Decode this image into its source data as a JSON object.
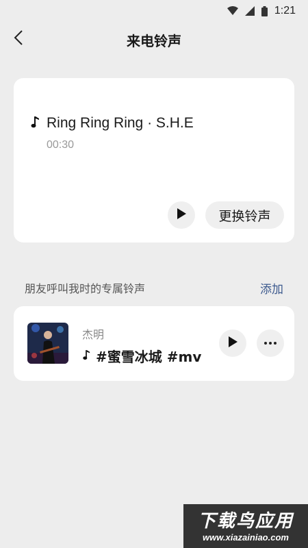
{
  "status_bar": {
    "time": "1:21",
    "icons": [
      "wifi-icon",
      "signal-icon",
      "battery-icon"
    ]
  },
  "header": {
    "title": "来电铃声",
    "back_icon": "back-arrow-icon"
  },
  "ringtone": {
    "title": "Ring Ring Ring · S.H.E",
    "duration": "00:30",
    "change_label": "更换铃声"
  },
  "friends_section": {
    "title": "朋友呼叫我时的专属铃声",
    "add_label": "添加",
    "items": [
      {
        "name": "杰明",
        "song": "#蜜雪冰城 #mv"
      }
    ]
  },
  "watermark": {
    "main": "下载鸟应用",
    "sub": "www.xiazainiao.com"
  },
  "colors": {
    "background": "#ededed",
    "card": "#ffffff",
    "link": "#3d5a8e",
    "button_bg": "#efefef"
  }
}
